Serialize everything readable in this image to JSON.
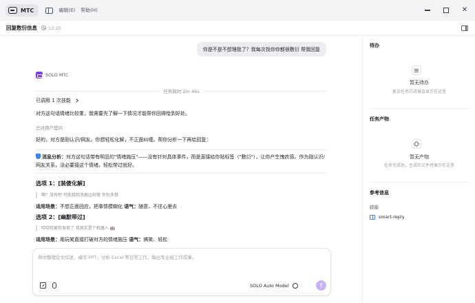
{
  "titlebar": {
    "app_name": "MTC",
    "menu": [
      "编辑(E)",
      "帮助(H)"
    ]
  },
  "header": {
    "title": "回复数衍信息",
    "time": "13:20"
  },
  "chat": {
    "user_message": "你是不是不想理我了？我每次找你你都很敷衍 帮我回复",
    "bot_name": "SOLO MTC",
    "task_time": "任务耗时 2m 46s",
    "skill_used": "已调用 1 次技能",
    "reasoning": "对方这句话情绪比较重，我需要先了解一下情况才能帮你回得恰到好处。",
    "asked_user": "已对用户提问",
    "user_reply": "好的，对方是刚认识/网友，你想轻松化解，不正面纠缠。帮你分析一下再给回复：",
    "analysis_label": "消息分析：",
    "analysis_text": "对方这句话带有明显的\"情绪施压\"——没有针对具体事件，而是直接给你贴标签（\"敷衍\"），让你产生愧疚感。作为刚认识/网友关系，没必要接这个情绪，轻松带过就好。",
    "options": [
      {
        "title": "选项 1：[装傻化解]",
        "quote": "啊？没有吧 可能我回消息比较慢 你别多想",
        "note_label": "适用场景：",
        "note_text": "不想正面回应，把事情模糊化 ",
        "tone_label": "语气：",
        "tone_text": "随意、不往心里去"
      },
      {
        "title": "选项 2：[幽默带过]",
        "quote": "哈哈哈被你发现了 我其实是个机器人 🤖",
        "note_label": "适用场景：",
        "note_text": "用玩笑直接打破对方的情绪施压 ",
        "tone_label": "语气：",
        "tone_text": "搞笑、轻松"
      }
    ]
  },
  "composer": {
    "placeholder": "帮你整理论文综述、编写 PPT、分析 Excel 等日常工作，输出专业级工作成果。",
    "model": "SOLO Auto Model"
  },
  "right_panel": {
    "todo": {
      "title": "待办",
      "empty_title": "暂无待办",
      "empty_desc": "复杂任务的进展会显示在这里"
    },
    "artifacts": {
      "title": "任务产物",
      "empty_title": "暂无产物",
      "empty_desc": "任务完成后，生成的文件将展示在这里"
    },
    "references": {
      "title": "参考信息",
      "skills_label": "技能",
      "skill_name": "smart-reply"
    }
  }
}
